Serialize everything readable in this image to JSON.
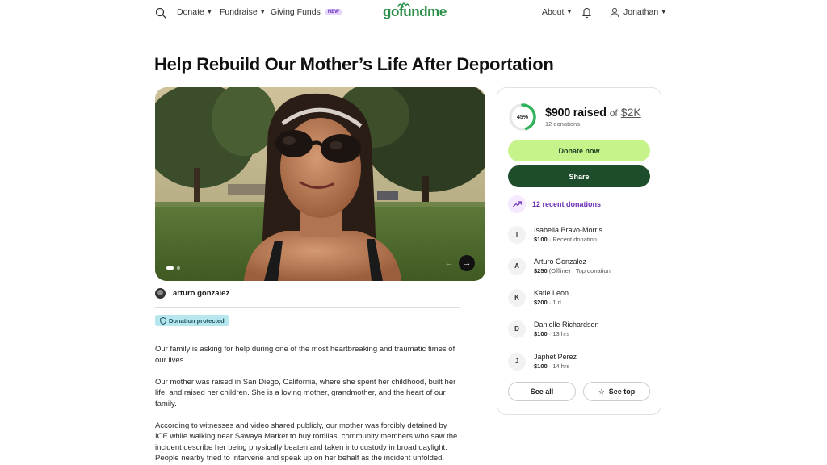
{
  "header": {
    "nav": [
      {
        "label": "Donate"
      },
      {
        "label": "Fundraise"
      },
      {
        "label": "Giving Funds",
        "badge": "NEW"
      }
    ],
    "logo": "gofundme",
    "about_label": "About",
    "user_name": "Jonathan"
  },
  "campaign": {
    "title": "Help Rebuild Our Mother’s Life After Deportation",
    "organizer": "arturo gonzalez",
    "protected_label": "Donation protected",
    "story": [
      "Our family is asking for help during one of the most heartbreaking and traumatic times of our lives.",
      "Our mother was raised in San Diego, California, where she spent her childhood, built her life, and raised her children. She is a loving mother, grandmother, and the heart of our family.",
      "According to witnesses and video shared publicly, our mother was forcibly detained by ICE while walking near Sawaya Market to buy tortillas. community members who saw the incident describe her being physically beaten and taken into custody in broad daylight. People nearby tried to intervene and speak up on her behalf as the incident unfolded."
    ]
  },
  "progress": {
    "percent_label": "45%",
    "percent": 45,
    "raised": "$900 raised",
    "of_label": "of",
    "goal": "$2K",
    "donations": "12 donations"
  },
  "actions": {
    "donate": "Donate now",
    "share": "Share"
  },
  "recent": {
    "label": "12 recent donations",
    "donors": [
      {
        "initial": "I",
        "name": "Isabella Bravo-Morris",
        "amount": "$100",
        "note": " · Recent donation"
      },
      {
        "initial": "A",
        "name": "Arturo Gonzalez",
        "amount": "$250",
        "note": " (Offline) · Top donation"
      },
      {
        "initial": "K",
        "name": "Katie Leon",
        "amount": "$200",
        "note": " · 1 d"
      },
      {
        "initial": "D",
        "name": "Danielle Richardson",
        "amount": "$100",
        "note": " · 13 hrs"
      },
      {
        "initial": "J",
        "name": "Japhet Perez",
        "amount": "$100",
        "note": " · 14 hrs"
      }
    ],
    "see_all": "See all",
    "see_top": "See top"
  },
  "colors": {
    "brand_green": "#2a8f47",
    "donate_btn": "#c6f38a",
    "share_btn": "#1e4d2b",
    "accent_purple": "#6b2fb6"
  }
}
